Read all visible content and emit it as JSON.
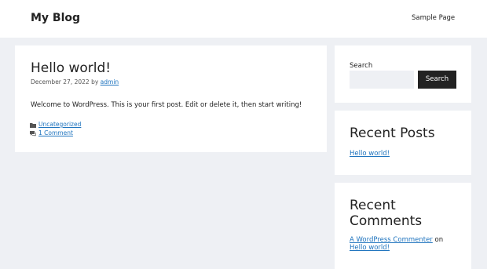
{
  "header": {
    "site_title": "My Blog",
    "nav": [
      {
        "label": "Sample Page"
      }
    ]
  },
  "post": {
    "title": "Hello world!",
    "date": "December 27, 2022",
    "by": "by",
    "author": "admin",
    "content": "Welcome to WordPress. This is your first post. Edit or delete it, then start writing!",
    "category": "Uncategorized",
    "comments": "1 Comment",
    "category_icon": "folder-icon",
    "comments_icon": "comment-bubble-icon"
  },
  "sidebar": {
    "search": {
      "label": "Search",
      "placeholder": "",
      "value": "",
      "button_label": "Search"
    },
    "recent_posts": {
      "title": "Recent Posts",
      "items": [
        {
          "label": "Hello world!"
        }
      ]
    },
    "recent_comments": {
      "title_line1": "Recent",
      "title_line2": "Comments",
      "items": [
        {
          "author": "A WordPress Commenter",
          "on": "on",
          "post": "Hello world!"
        }
      ]
    }
  },
  "colors": {
    "background": "#eef0f4",
    "link": "#1e73be",
    "button": "#222222",
    "text": "#222222"
  }
}
